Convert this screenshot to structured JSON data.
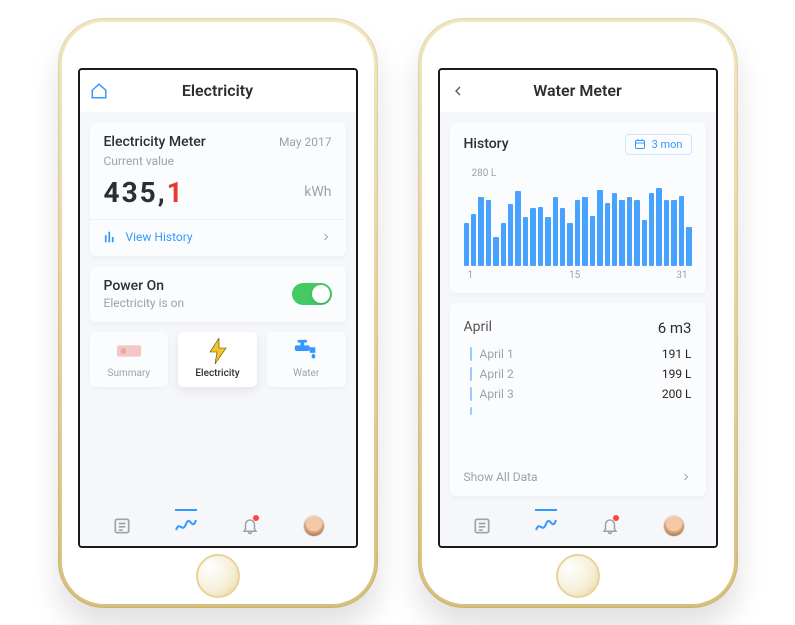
{
  "left_phone": {
    "header": {
      "title": "Electricity"
    },
    "meter_card": {
      "title": "Electricity Meter",
      "date": "May 2017",
      "subtitle": "Current value",
      "value_main": "435,",
      "value_frac": "1",
      "unit": "kWh",
      "history_label": "View History"
    },
    "power_card": {
      "title": "Power On",
      "subtitle": "Electricity is on"
    },
    "tiles": {
      "summary": "Summary",
      "electricity": "Electricity",
      "water": "Water"
    }
  },
  "right_phone": {
    "header": {
      "title": "Water Meter"
    },
    "history_card": {
      "title": "History",
      "range_label": "3 mon",
      "peak_label": "280 L",
      "x_min": "1",
      "x_mid": "15",
      "x_max": "31"
    },
    "month_card": {
      "month": "April",
      "total": "6 m3",
      "rows": [
        {
          "label": "April 1",
          "value": "191 L"
        },
        {
          "label": "April 2",
          "value": "199 L"
        },
        {
          "label": "April 3",
          "value": "200 L"
        }
      ],
      "show_all_label": "Show All Data"
    }
  },
  "chart_data": {
    "type": "bar",
    "title": "History",
    "ylabel": "L",
    "ylim": [
      0,
      280
    ],
    "x": [
      1,
      2,
      3,
      4,
      5,
      6,
      7,
      8,
      9,
      10,
      11,
      12,
      13,
      14,
      15,
      16,
      17,
      18,
      19,
      20,
      21,
      22,
      23,
      24,
      25,
      26,
      27,
      28,
      29,
      30,
      31
    ],
    "values": [
      150,
      180,
      240,
      230,
      100,
      150,
      215,
      260,
      170,
      200,
      205,
      170,
      240,
      200,
      150,
      230,
      240,
      175,
      265,
      220,
      255,
      230,
      240,
      230,
      160,
      255,
      270,
      230,
      230,
      245,
      135
    ]
  }
}
